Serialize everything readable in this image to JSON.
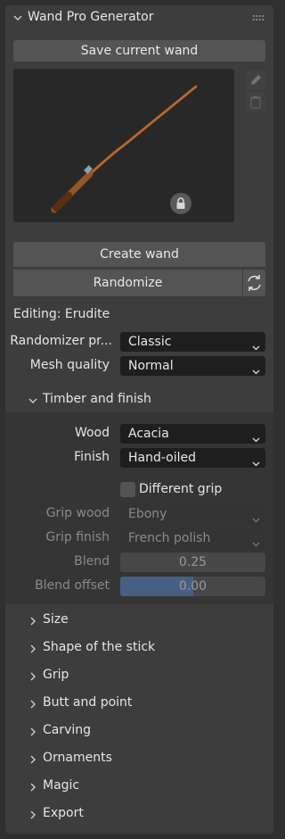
{
  "panel": {
    "title": "Wand Pro Generator",
    "save_label": "Save current wand",
    "create_label": "Create wand",
    "randomize_label": "Randomize",
    "editing_text": "Editing: Erudite",
    "randomizer": {
      "label": "Randomizer pr...",
      "value": "Classic"
    },
    "mesh_quality": {
      "label": "Mesh quality",
      "value": "Normal"
    }
  },
  "timber": {
    "title": "Timber and finish",
    "wood": {
      "label": "Wood",
      "value": "Acacia"
    },
    "finish": {
      "label": "Finish",
      "value": "Hand-oiled"
    },
    "different_grip": {
      "label": "Different grip",
      "checked": false
    },
    "grip_wood": {
      "label": "Grip wood",
      "value": "Ebony"
    },
    "grip_finish": {
      "label": "Grip finish",
      "value": "French polish"
    },
    "blend": {
      "label": "Blend",
      "value": "0.25"
    },
    "blend_offset": {
      "label": "Blend offset",
      "value": "0.00",
      "fill_fraction": 0.5
    }
  },
  "sections": [
    {
      "title": "Size"
    },
    {
      "title": "Shape of the stick"
    },
    {
      "title": "Grip"
    },
    {
      "title": "Butt and point"
    },
    {
      "title": "Carving"
    },
    {
      "title": "Ornaments"
    },
    {
      "title": "Magic"
    },
    {
      "title": "Export"
    }
  ],
  "icons": {
    "collapse": "chevron-down-icon",
    "expand": "chevron-right-icon",
    "edit": "pencil-icon",
    "delete": "trash-icon",
    "lock": "lock-icon",
    "refresh": "refresh-icon",
    "drag": "drag-handle-icon"
  },
  "colors": {
    "accent": "#4772b3",
    "panel": "#3d3d3d",
    "button": "#545454",
    "dropdown": "#1e1e1e"
  }
}
